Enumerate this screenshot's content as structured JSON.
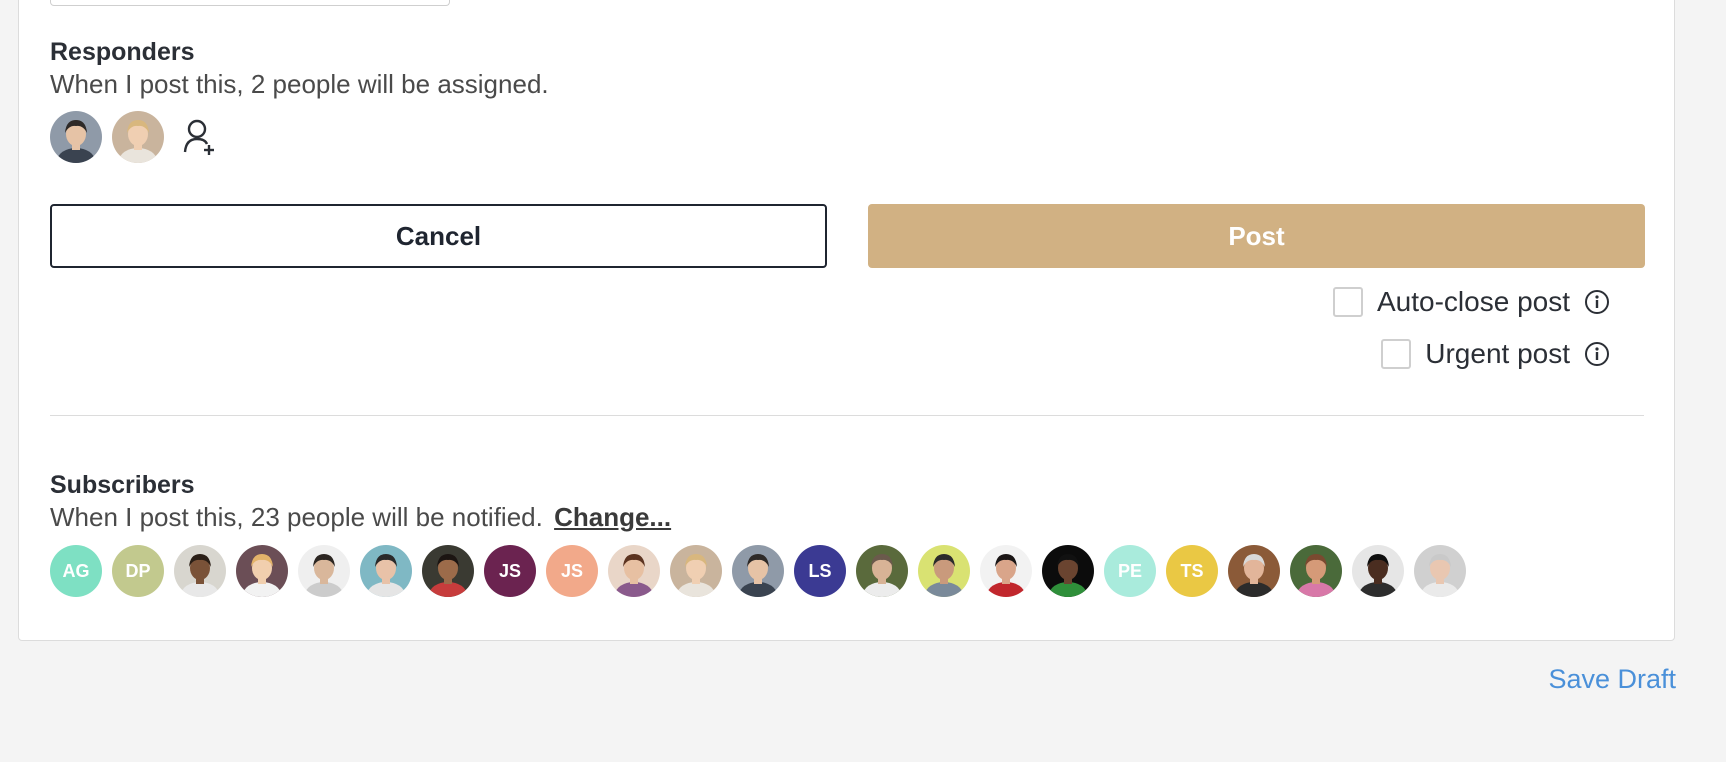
{
  "responders": {
    "title": "Responders",
    "description": "When I post this, 2 people will be assigned.",
    "avatars": [
      {
        "type": "photo",
        "skin": "#e6c3a6",
        "hair": "#2e2a28",
        "bg": "#8f9aa8",
        "shirt": "#3a4350"
      },
      {
        "type": "photo",
        "skin": "#f0cfb2",
        "hair": "#d8b77e",
        "bg": "#c9b49d",
        "shirt": "#e9e4dc"
      }
    ],
    "add_icon": "add-user-icon"
  },
  "actions": {
    "cancel_label": "Cancel",
    "post_label": "Post"
  },
  "options": {
    "auto_close_label": "Auto-close post",
    "urgent_label": "Urgent post",
    "info_icon": "info-icon"
  },
  "subscribers": {
    "title": "Subscribers",
    "description": "When I post this, 23 people will be notified.",
    "change_label": "Change...",
    "avatars": [
      {
        "type": "initials",
        "text": "AG",
        "bg": "#7ee0c3"
      },
      {
        "type": "initials",
        "text": "DP",
        "bg": "#c2c98e"
      },
      {
        "type": "photo",
        "skin": "#7a5238",
        "hair": "#2a1e16",
        "bg": "#d8d6cf",
        "shirt": "#e8e8e8"
      },
      {
        "type": "photo",
        "skin": "#f1cfae",
        "hair": "#e3b36a",
        "bg": "#6b4e56",
        "shirt": "#f2f2f2"
      },
      {
        "type": "photo",
        "skin": "#d9b79b",
        "hair": "#2c2622",
        "bg": "#efefef",
        "shirt": "#cccccc"
      },
      {
        "type": "photo",
        "skin": "#e8c2a8",
        "hair": "#2a2a2a",
        "bg": "#7fb8c4",
        "shirt": "#e5e5e5"
      },
      {
        "type": "photo",
        "skin": "#9c6b4a",
        "hair": "#1c1512",
        "bg": "#3a3a32",
        "shirt": "#c73c3c"
      },
      {
        "type": "initials",
        "text": "JS",
        "bg": "#6b2350"
      },
      {
        "type": "initials",
        "text": "JS",
        "bg": "#f2a98a"
      },
      {
        "type": "photo",
        "skin": "#e7c0a2",
        "hair": "#5c3421",
        "bg": "#e9d6c8",
        "shirt": "#8a5a8c"
      },
      {
        "type": "photo",
        "skin": "#f0cfb2",
        "hair": "#d8b77e",
        "bg": "#c9b49d",
        "shirt": "#e9e4dc"
      },
      {
        "type": "photo",
        "skin": "#e6c3a6",
        "hair": "#2e2a28",
        "bg": "#8f9aa8",
        "shirt": "#3a4350"
      },
      {
        "type": "initials",
        "text": "LS",
        "bg": "#3b3a93"
      },
      {
        "type": "photo",
        "skin": "#d8b396",
        "hair": "#6b5a4c",
        "bg": "#5a6a3c",
        "shirt": "#ececec"
      },
      {
        "type": "photo",
        "skin": "#c99a7c",
        "hair": "#2b2b2b",
        "bg": "#d9e272",
        "shirt": "#7a8a9a"
      },
      {
        "type": "photo",
        "skin": "#d9a58a",
        "hair": "#1b1616",
        "bg": "#f2f2f2",
        "shirt": "#c1272d"
      },
      {
        "type": "photo",
        "skin": "#6a4430",
        "hair": "#111111",
        "bg": "#0c0c0c",
        "shirt": "#2f8f3a"
      },
      {
        "type": "initials",
        "text": "PE",
        "bg": "#a9ebdc"
      },
      {
        "type": "initials",
        "text": "TS",
        "bg": "#eac844"
      },
      {
        "type": "photo",
        "skin": "#e2b59a",
        "hair": "#d9d9d9",
        "bg": "#8b5a38",
        "shirt": "#2b2b2b"
      },
      {
        "type": "photo",
        "skin": "#d59a78",
        "hair": "#7a4a30",
        "bg": "#4a6a3a",
        "shirt": "#d878a8"
      },
      {
        "type": "photo",
        "skin": "#4a2d20",
        "hair": "#0e0e0e",
        "bg": "#e6e6e6",
        "shirt": "#2d2d2d"
      },
      {
        "type": "photo",
        "skin": "#e9c7b1",
        "hair": "#c9c9c9",
        "bg": "#d0d0d0",
        "shirt": "#eaeaea"
      }
    ]
  },
  "footer": {
    "save_draft_label": "Save Draft"
  },
  "colors": {
    "post_button": "#d1b183",
    "link": "#4a90d9",
    "text": "#2b2f36"
  }
}
